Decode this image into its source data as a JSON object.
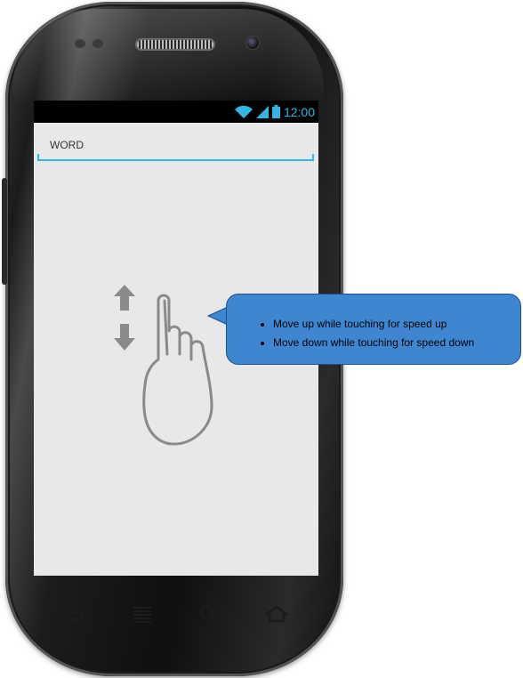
{
  "status_bar": {
    "time": "12:00",
    "icons": [
      "wifi-icon",
      "signal-icon",
      "battery-icon"
    ],
    "accent_color": "#33b5e5"
  },
  "word_field": {
    "placeholder": "WORD",
    "value": ""
  },
  "gesture_hint": {
    "icons": [
      "arrow-up-icon",
      "arrow-down-icon",
      "touch-hand-icon"
    ],
    "tips": [
      "Move up while touching for speed up",
      "Move down while touching for speed down"
    ]
  },
  "navigation": {
    "icons": [
      "back-icon",
      "menu-icon",
      "search-icon",
      "home-icon"
    ]
  },
  "colors": {
    "screen_background": "#e8e8e8",
    "callout_background": "#3f86d0"
  }
}
